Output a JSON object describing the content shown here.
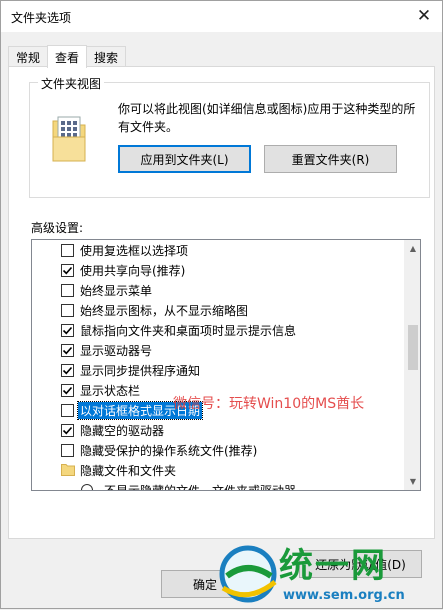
{
  "window": {
    "title": "文件夹选项",
    "close_glyph": "✕"
  },
  "tabs": [
    {
      "label": "常规",
      "active": false
    },
    {
      "label": "查看",
      "active": true
    },
    {
      "label": "搜索",
      "active": false
    }
  ],
  "folder_view": {
    "title": "文件夹视图",
    "description": "你可以将此视图(如详细信息或图标)应用于这种类型的所有文件夹。",
    "apply_button": "应用到文件夹(L)",
    "reset_button": "重置文件夹(R)"
  },
  "advanced": {
    "label": "高级设置:",
    "items": [
      {
        "kind": "checkbox",
        "label": "使用复选框以选择项",
        "checked": false
      },
      {
        "kind": "checkbox",
        "label": "使用共享向导(推荐)",
        "checked": true
      },
      {
        "kind": "checkbox",
        "label": "始终显示菜单",
        "checked": false
      },
      {
        "kind": "checkbox",
        "label": "始终显示图标，从不显示缩略图",
        "checked": false
      },
      {
        "kind": "checkbox",
        "label": "鼠标指向文件夹和桌面项时显示提示信息",
        "checked": true
      },
      {
        "kind": "checkbox",
        "label": "显示驱动器号",
        "checked": true
      },
      {
        "kind": "checkbox",
        "label": "显示同步提供程序通知",
        "checked": true
      },
      {
        "kind": "checkbox",
        "label": "显示状态栏",
        "checked": true
      },
      {
        "kind": "checkbox",
        "label": "以对话框格式显示日期",
        "checked": false,
        "selected": true
      },
      {
        "kind": "checkbox",
        "label": "隐藏空的驱动器",
        "checked": true
      },
      {
        "kind": "checkbox",
        "label": "隐藏受保护的操作系统文件(推荐)",
        "checked": false
      },
      {
        "kind": "folder",
        "label": "隐藏文件和文件夹"
      },
      {
        "kind": "radio",
        "label": "不显示隐藏的文件、文件夹或驱动器",
        "checked": false
      }
    ],
    "restore_button": "还原为默认值(D)"
  },
  "footer": {
    "ok_button": "确定"
  },
  "overlay": {
    "watermark": "微信号：玩转Win10的MS酋长",
    "logo_text": "统一网",
    "logo_url": "www.sem.org.cn"
  },
  "colors": {
    "accent": "#0078d7",
    "watermark": "#e23a3a",
    "logo_green": "#1a9a3a"
  }
}
